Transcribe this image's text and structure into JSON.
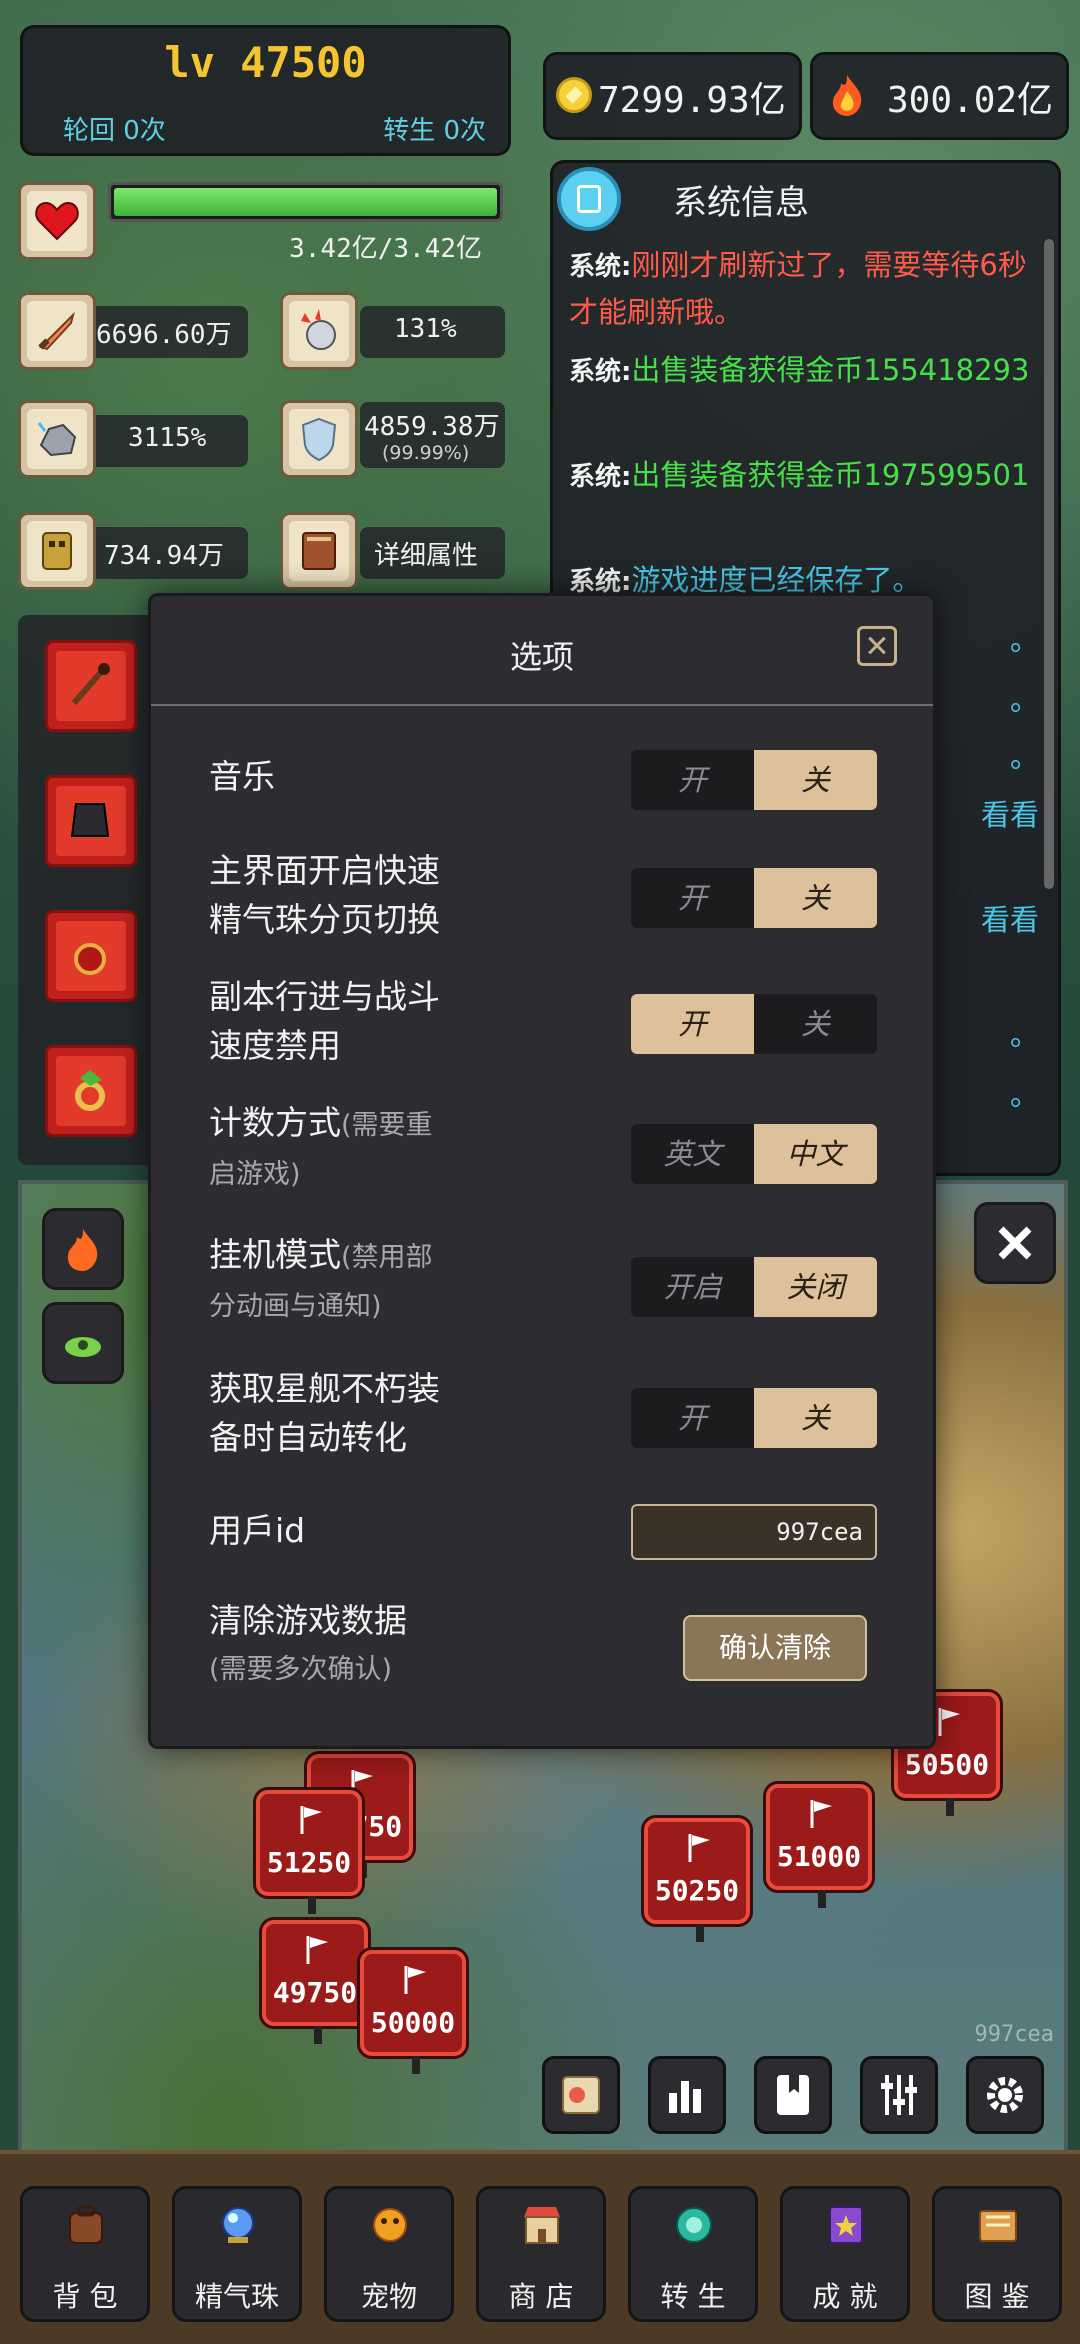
{
  "player": {
    "level": "lv 47500",
    "rebirth_cycle": "轮回 0次",
    "reincarnation": "转生 0次",
    "hp_text": "3.42亿/3.42亿",
    "hp_fraction": 1.0
  },
  "currency": {
    "gold": "7299.93亿",
    "flame": "300.02亿"
  },
  "stats": {
    "attack": "6696.60万",
    "crit": "131%",
    "crit_dmg": "3115%",
    "defense": "4859.38万",
    "defense_pct": "(99.99%)",
    "power": "734.94万",
    "details": "详细属性"
  },
  "system_panel": {
    "title": "系统信息",
    "tag": "系统:",
    "messages": [
      {
        "text": "刚刚才刷新过了，需要等待6秒才能刷新哦。",
        "color": "#ff5a4a"
      },
      {
        "text": "出售装备获得金币155418293",
        "color": "#48e04a"
      },
      {
        "text": "出售装备获得金币197599501",
        "color": "#48e04a"
      },
      {
        "text": "游戏进度已经保存了。",
        "color": "#4ac8e8"
      }
    ],
    "peek_texts": [
      "。",
      "。",
      "。",
      "。",
      "看看",
      "看看",
      "。",
      "。"
    ]
  },
  "modal": {
    "title": "选项",
    "options": [
      {
        "label1": "音乐",
        "label2": "",
        "hint": "",
        "left": "开",
        "right": "关",
        "selected": "right"
      },
      {
        "label1": "主界面开启快速",
        "label2": "精气珠分页切换",
        "hint": "",
        "left": "开",
        "right": "关",
        "selected": "right"
      },
      {
        "label1": "副本行进与战斗",
        "label2": "速度禁用",
        "hint": "",
        "left": "开",
        "right": "关",
        "selected": "left"
      },
      {
        "label1": "计数方式",
        "label2": "",
        "hint1": "(需要重",
        "hint2": "启游戏)",
        "left": "英文",
        "right": "中文",
        "selected": "right"
      },
      {
        "label1": "挂机模式",
        "label2": "",
        "hint1": "(禁用部",
        "hint2": "分动画与通知)",
        "left": "开启",
        "right": "关闭",
        "selected": "right"
      },
      {
        "label1": "获取星舰不朽装",
        "label2": "备时自动转化",
        "hint": "",
        "left": "开",
        "right": "关",
        "selected": "right"
      }
    ],
    "user_id_label": "用戶id",
    "user_id_value": "997cea",
    "clear_label": "清除游戏数据",
    "clear_hint": "(需要多次确认)",
    "clear_button": "确认清除"
  },
  "map": {
    "watermark": "997cea",
    "stages": [
      "51250",
      "50750",
      "49750",
      "50000",
      "50250",
      "51000",
      "50500"
    ]
  },
  "nav": [
    {
      "label": "背 包",
      "icon": "backpack-icon"
    },
    {
      "label": "精气珠",
      "icon": "orb-icon"
    },
    {
      "label": "宠物",
      "icon": "pet-icon"
    },
    {
      "label": "商 店",
      "icon": "shop-icon"
    },
    {
      "label": "转 生",
      "icon": "rebirth-icon"
    },
    {
      "label": "成 就",
      "icon": "achievement-icon"
    },
    {
      "label": "图 鉴",
      "icon": "codex-icon"
    }
  ],
  "colors": {
    "gold_text": "#f4c431",
    "toggle_on": "#dcc19b",
    "hp_bar": "#5fd04a",
    "stage_red": "#9b1a1a"
  }
}
